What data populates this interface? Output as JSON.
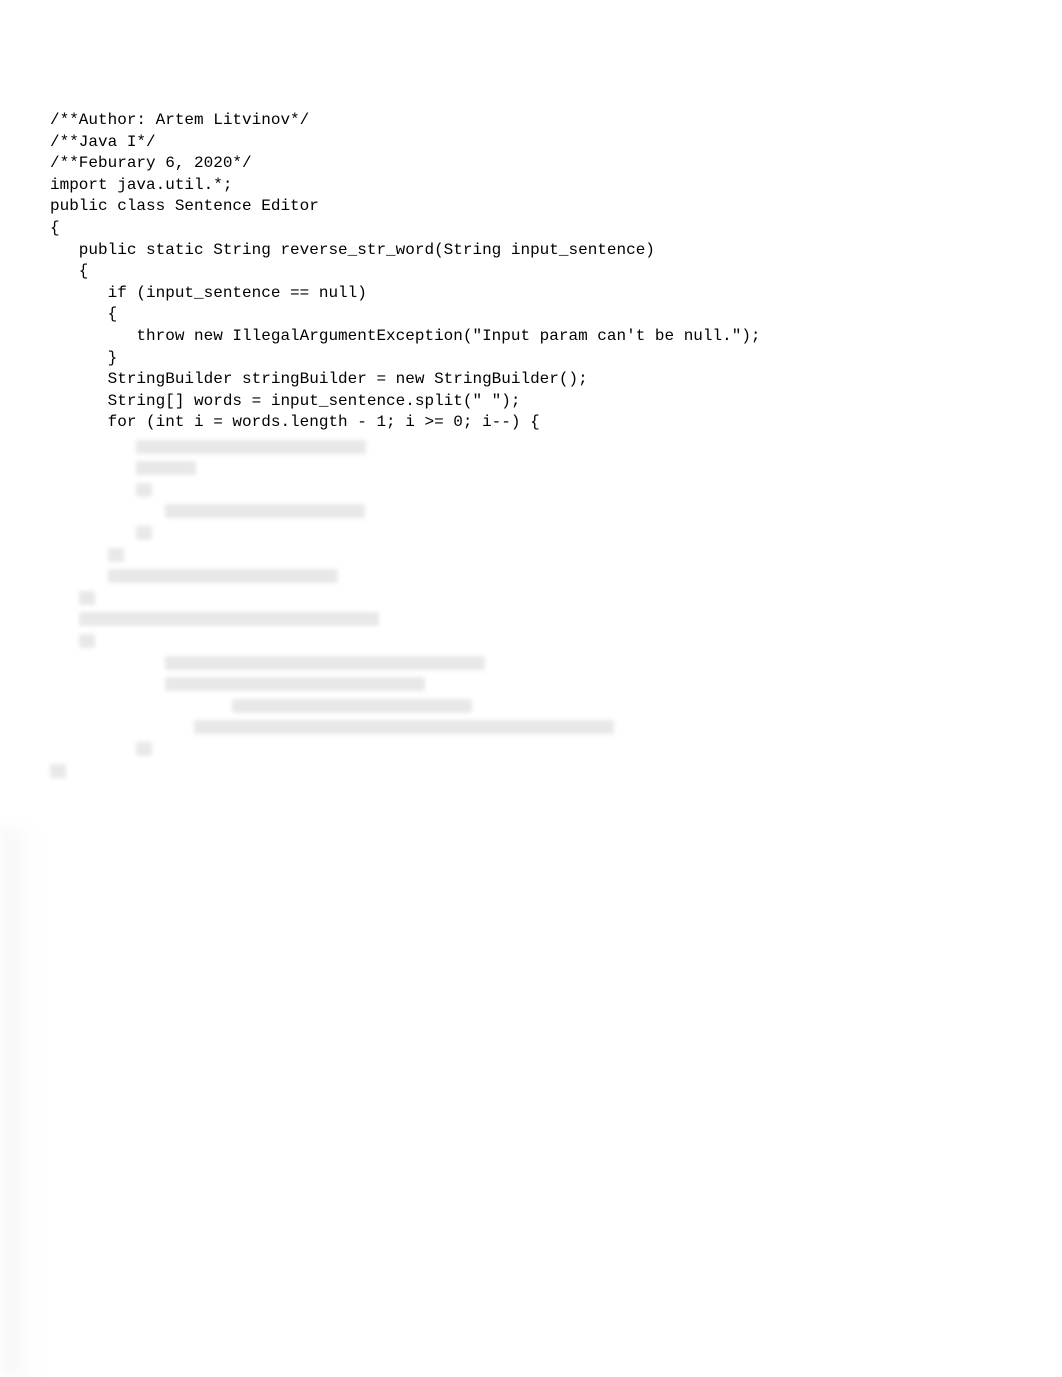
{
  "code": {
    "lines": [
      "/**Author: Artem Litvinov*/",
      "/**Java I*/",
      "/**Feburary 6, 2020*/",
      "import java.util.*;",
      "public class Sentence Editor",
      "{",
      "   public static String reverse_str_word(String input_sentence)",
      "   {",
      "      if (input_sentence == null)",
      "      {",
      "         throw new IllegalArgumentException(\"Input param can't be null.\");",
      "      }",
      "      StringBuilder stringBuilder = new StringBuilder();",
      "      String[] words = input_sentence.split(\" \");",
      "      for (int i = words.length - 1; i >= 0; i--) {"
    ]
  },
  "blurred": {
    "rows": [
      {
        "indent": "         ",
        "widths": [
          230
        ]
      },
      {
        "indent": "         ",
        "widths": [
          60
        ]
      },
      {
        "indent": "         ",
        "widths": [
          16
        ]
      },
      {
        "indent": "            ",
        "widths": [
          200
        ]
      },
      {
        "indent": "         ",
        "widths": [
          16
        ]
      },
      {
        "indent": "      ",
        "widths": [
          16
        ]
      },
      {
        "indent": "      ",
        "widths": [
          230
        ]
      },
      {
        "indent": "   ",
        "widths": [
          16
        ]
      },
      {
        "indent": "   ",
        "widths": [
          300
        ]
      },
      {
        "indent": "   ",
        "widths": [
          16
        ]
      },
      {
        "indent": "            ",
        "widths": [
          320
        ]
      },
      {
        "indent": "            ",
        "widths": [
          260
        ]
      },
      {
        "indent": "                   ",
        "widths": [
          240
        ]
      },
      {
        "indent": "               ",
        "widths": [
          420
        ]
      },
      {
        "indent": "         ",
        "widths": [
          16
        ]
      },
      {
        "indent": "",
        "widths": [
          16
        ]
      }
    ]
  }
}
